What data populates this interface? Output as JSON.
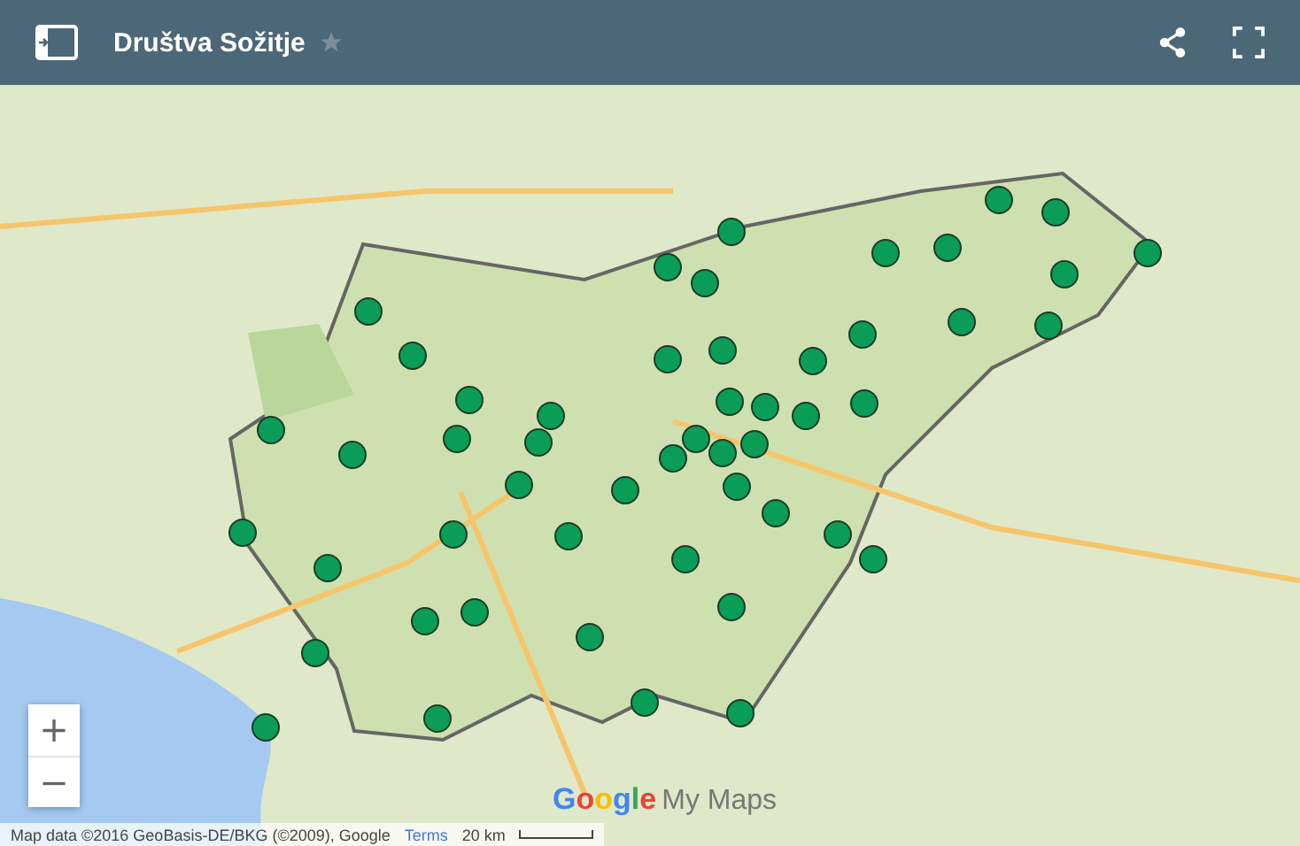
{
  "header": {
    "title": "Društva Sožitje",
    "starred": false
  },
  "map": {
    "zoom_in": "+",
    "zoom_out": "−",
    "logo": {
      "brand": "Google",
      "product": "My Maps"
    }
  },
  "footer": {
    "attribution": "Map data ©2016 GeoBasis-DE/BKG (©2009), Google",
    "terms": "Terms",
    "scale": "20 km"
  }
}
